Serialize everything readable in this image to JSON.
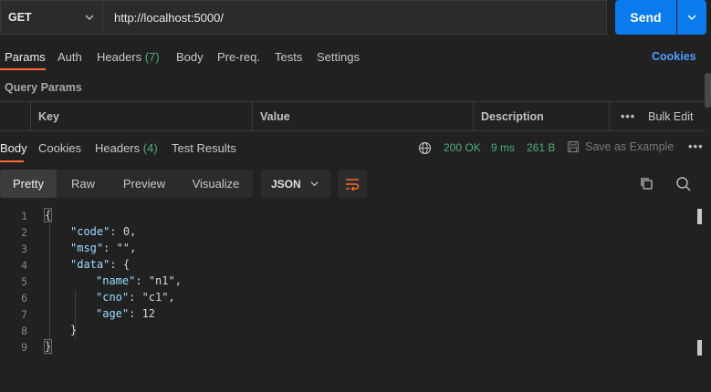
{
  "request": {
    "method": "GET",
    "url": "http://localhost:5000/",
    "send_label": "Send"
  },
  "request_tabs": [
    {
      "label": "Params",
      "count": ""
    },
    {
      "label": "Auth",
      "count": ""
    },
    {
      "label": "Headers",
      "count": "(7)"
    },
    {
      "label": "Body",
      "count": ""
    },
    {
      "label": "Pre-req.",
      "count": ""
    },
    {
      "label": "Tests",
      "count": ""
    },
    {
      "label": "Settings",
      "count": ""
    }
  ],
  "cookies_label": "Cookies",
  "query_params_label": "Query Params",
  "params_table": {
    "columns": [
      "Key",
      "Value",
      "Description"
    ],
    "bulk_edit_label": "Bulk Edit"
  },
  "response_tabs": [
    {
      "label": "Body",
      "count": ""
    },
    {
      "label": "Cookies",
      "count": ""
    },
    {
      "label": "Headers",
      "count": "(4)"
    },
    {
      "label": "Test Results",
      "count": ""
    }
  ],
  "response_status": {
    "status": "200 OK",
    "time": "9 ms",
    "size": "261 B",
    "save_label": "Save as Example"
  },
  "view_modes": [
    "Pretty",
    "Raw",
    "Preview",
    "Visualize"
  ],
  "format": "JSON",
  "code_lines": [
    {
      "n": "1",
      "text": "{"
    },
    {
      "n": "2",
      "text": "\"code\": 0,"
    },
    {
      "n": "3",
      "text": "\"msg\": \"\","
    },
    {
      "n": "4",
      "text": "\"data\": {"
    },
    {
      "n": "5",
      "text": "\"name\": \"n1\","
    },
    {
      "n": "6",
      "text": "\"cno\": \"c1\","
    },
    {
      "n": "7",
      "text": "\"age\": 12"
    },
    {
      "n": "8",
      "text": "}"
    },
    {
      "n": "9",
      "text": "}"
    }
  ],
  "colors": {
    "accent": "#ff6c37",
    "send": "#097bed",
    "success": "#4caf7d",
    "link": "#4a9fff"
  },
  "icons": [
    "chevron-down-icon",
    "globe-icon",
    "save-icon",
    "more-icon",
    "wrap-lines-icon",
    "copy-icon",
    "search-icon"
  ]
}
